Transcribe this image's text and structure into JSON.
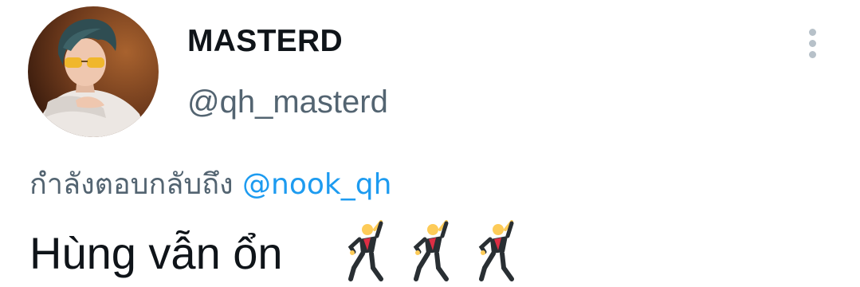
{
  "user": {
    "display_name": "MASTERD",
    "handle": "@qh_masterd"
  },
  "reply": {
    "prefix": "กำลังตอบกลับถึง",
    "mention": "@nook_qh"
  },
  "tweet": {
    "text": "Hùng vẫn ổn",
    "emojis": [
      "dancing-man-emoji",
      "dancing-man-emoji",
      "dancing-man-emoji"
    ]
  },
  "colors": {
    "primary_text": "#0f1419",
    "secondary_text": "#536471",
    "link": "#1d9bf0",
    "more_icon": "#b7c1c9"
  },
  "icons": {
    "more": "vertical-ellipsis-icon"
  }
}
